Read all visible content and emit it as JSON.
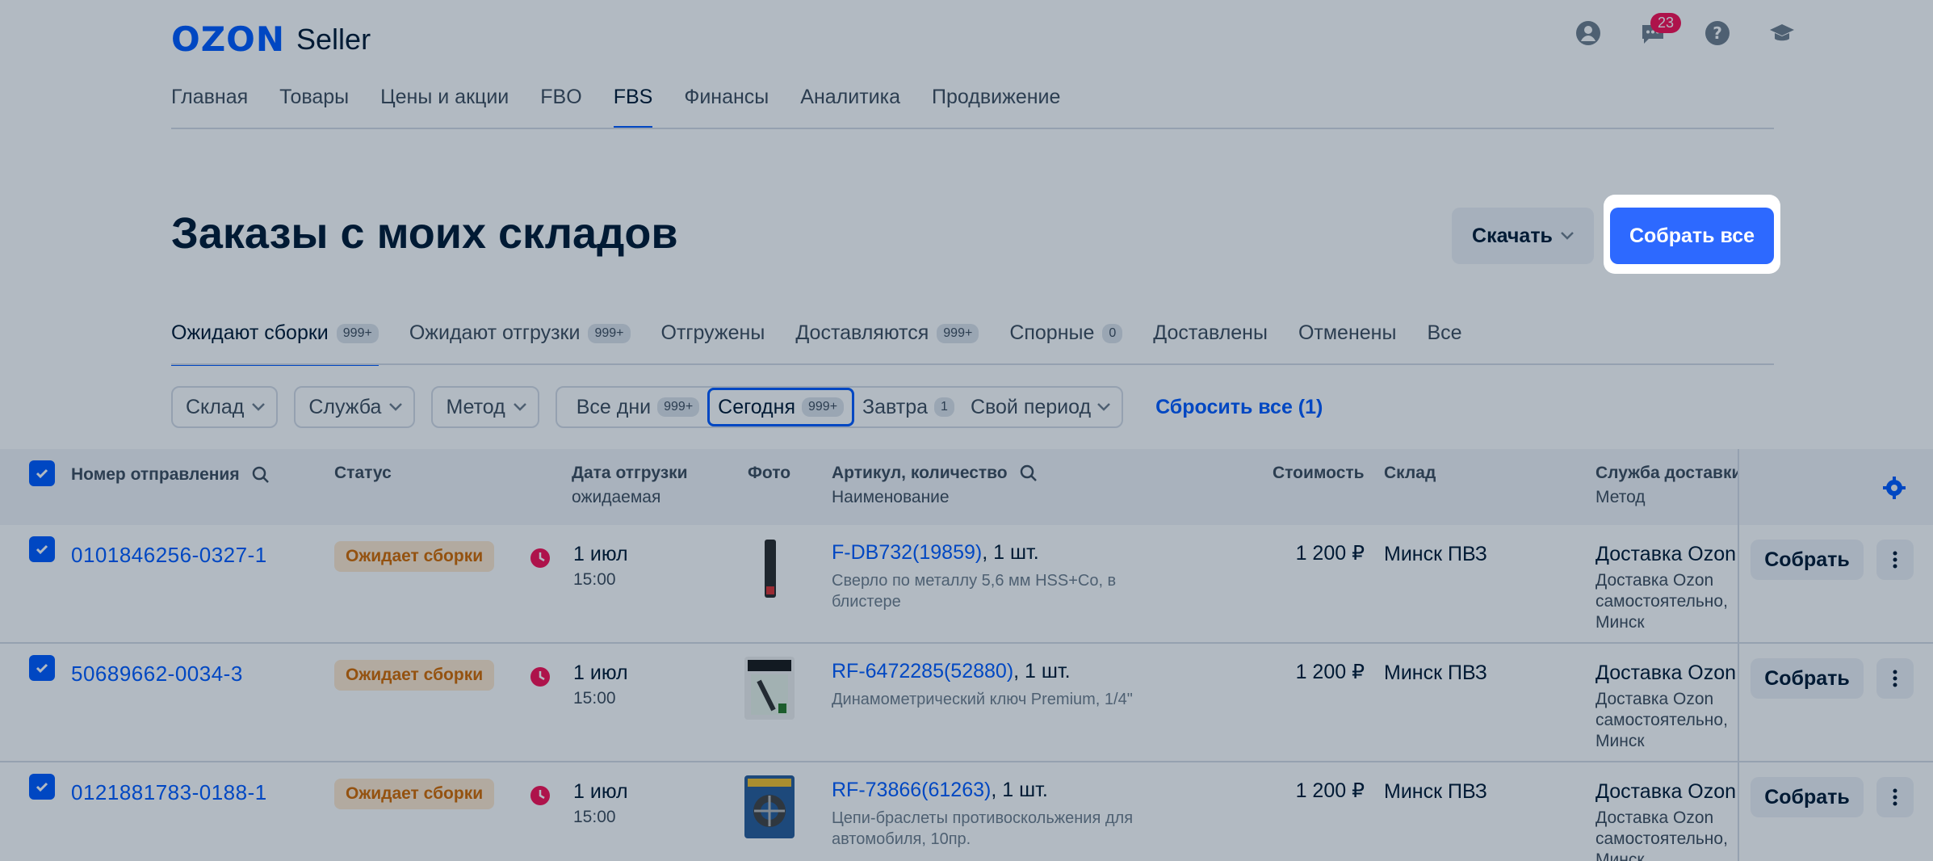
{
  "header": {
    "logo_brand": "OZON",
    "logo_product": "Seller",
    "notifications_count": "23",
    "icons": [
      "user-icon",
      "chat-icon",
      "help-icon",
      "graduation-cap-icon"
    ]
  },
  "nav": {
    "items": [
      {
        "label": "Главная"
      },
      {
        "label": "Товары"
      },
      {
        "label": "Цены и акции"
      },
      {
        "label": "FBO"
      },
      {
        "label": "FBS",
        "active": true
      },
      {
        "label": "Финансы"
      },
      {
        "label": "Аналитика"
      },
      {
        "label": "Продвижение"
      }
    ]
  },
  "page": {
    "title": "Заказы с моих складов",
    "download_label": "Скачать",
    "collect_all_label": "Собрать все"
  },
  "tabs": [
    {
      "label": "Ожидают сборки",
      "count": "999+",
      "active": true
    },
    {
      "label": "Ожидают отгрузки",
      "count": "999+"
    },
    {
      "label": "Отгружены",
      "count": null
    },
    {
      "label": "Доставляются",
      "count": "999+"
    },
    {
      "label": "Спорные",
      "count": "0"
    },
    {
      "label": "Доставлены",
      "count": null
    },
    {
      "label": "Отменены",
      "count": null
    },
    {
      "label": "Все",
      "count": null
    }
  ],
  "filters": {
    "warehouse": "Склад",
    "service": "Служба",
    "method": "Метод",
    "all_days": "Все дни",
    "all_days_count": "999+",
    "today": "Сегодня",
    "today_count": "999+",
    "tomorrow": "Завтра",
    "tomorrow_count": "1",
    "custom_period": "Свой период",
    "reset": "Сбросить все (1)"
  },
  "table": {
    "headers": {
      "number": "Номер отправления",
      "status": "Статус",
      "date": "Дата отгрузки",
      "date_sub": "ожидаемая",
      "photo": "Фото",
      "article": "Артикул, количество",
      "article_sub": "Наименование",
      "cost": "Стоимость",
      "warehouse": "Склад",
      "service": "Служба доставки",
      "service_sub": "Метод"
    },
    "rows": [
      {
        "number": "0101846256-0327-1",
        "status": "Ожидает сборки",
        "date": "1 июл",
        "time": "15:00",
        "article": "F-DB732(19859)",
        "qty": ", 1 шт.",
        "name": "Сверло по металлу 5,6 мм HSS+Co, в блистере",
        "price": "1 200 ₽",
        "warehouse": "Минск ПВЗ",
        "service": "Доставка Ozon",
        "method": "Доставка Ozon самостоятельно, Минск",
        "collect": "Собрать"
      },
      {
        "number": "50689662-0034-3",
        "status": "Ожидает сборки",
        "date": "1 июл",
        "time": "15:00",
        "article": "RF-6472285(52880)",
        "qty": ", 1 шт.",
        "name": "Динамометрический ключ Premium, 1/4\"",
        "price": "1 200 ₽",
        "warehouse": "Минск ПВЗ",
        "service": "Доставка Ozon",
        "method": "Доставка Ozon самостоятельно, Минск",
        "collect": "Собрать"
      },
      {
        "number": "0121881783-0188-1",
        "status": "Ожидает сборки",
        "date": "1 июл",
        "time": "15:00",
        "article": "RF-73866(61263)",
        "qty": ", 1 шт.",
        "name": "Цепи-браслеты противоскольжения для автомобиля, 10пр.",
        "price": "1 200 ₽",
        "warehouse": "Минск ПВЗ",
        "service": "Доставка Ozon",
        "method": "Доставка Ozon самостоятельно, Минск",
        "collect": "Собрать"
      }
    ]
  },
  "colors": {
    "accent": "#005bff",
    "status_bg": "#ffe9cf",
    "status_text": "#d46a00",
    "badge": "#f91155"
  }
}
